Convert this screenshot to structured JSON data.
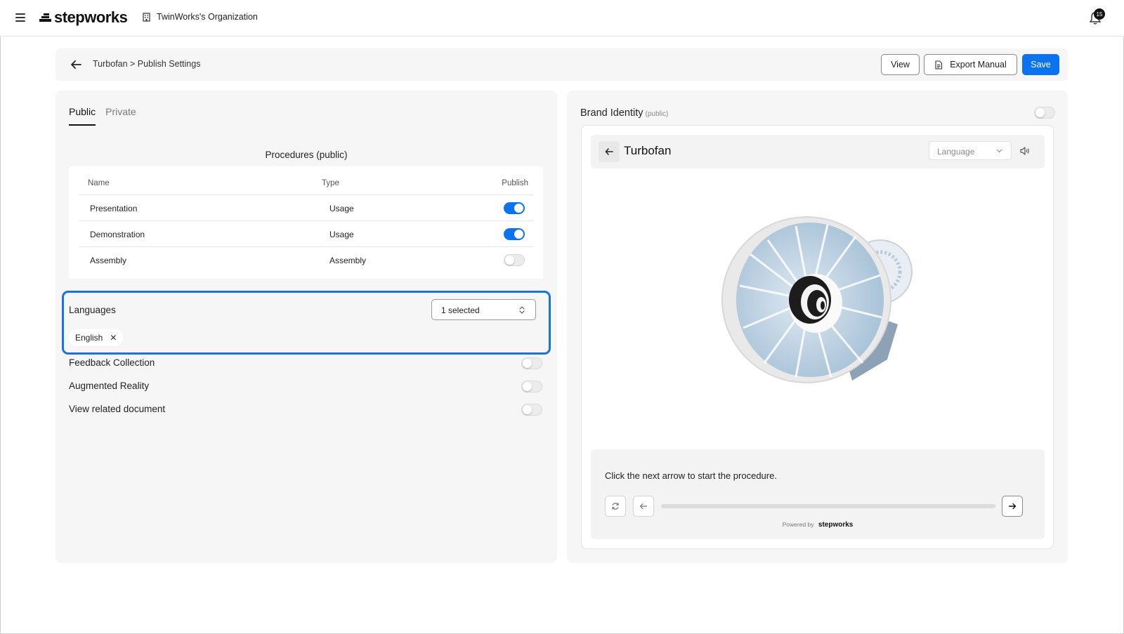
{
  "header": {
    "brand": "stepworks",
    "organization": "TwinWorks's Organization",
    "notifications_count": "15"
  },
  "breadcrumb": {
    "path": "Turbofan > Publish Settings",
    "view_label": "View",
    "export_label": "Export Manual",
    "save_label": "Save"
  },
  "left": {
    "tabs": [
      {
        "label": "Public",
        "active": true
      },
      {
        "label": "Private",
        "active": false
      }
    ],
    "procedures_title": "Procedures (public)",
    "table": {
      "columns": [
        "Name",
        "Type",
        "Publish"
      ],
      "rows": [
        {
          "name": "Presentation",
          "type": "Usage",
          "publish": true
        },
        {
          "name": "Demonstration",
          "type": "Usage",
          "publish": true
        },
        {
          "name": "Assembly",
          "type": "Assembly",
          "publish": false
        }
      ]
    },
    "languages": {
      "label": "Languages",
      "selected_text": "1 selected",
      "chips": [
        "English"
      ]
    },
    "options": [
      {
        "label": "Feedback Collection",
        "enabled": false
      },
      {
        "label": "Augmented Reality",
        "enabled": false
      },
      {
        "label": "View related document",
        "enabled": false
      }
    ]
  },
  "right": {
    "brand_identity": "Brand Identity",
    "brand_identity_tag": "(public)",
    "brand_identity_enabled": false,
    "preview": {
      "title": "Turbofan",
      "language_placeholder": "Language",
      "instruction": "Click the next arrow to start the procedure.",
      "progress": 0,
      "powered_by": "Powered by",
      "powered_brand": "stepworks"
    }
  },
  "colors": {
    "accent": "#0b72f0",
    "highlight_border": "#1573e6",
    "panel_bg": "#f6f6f6"
  }
}
